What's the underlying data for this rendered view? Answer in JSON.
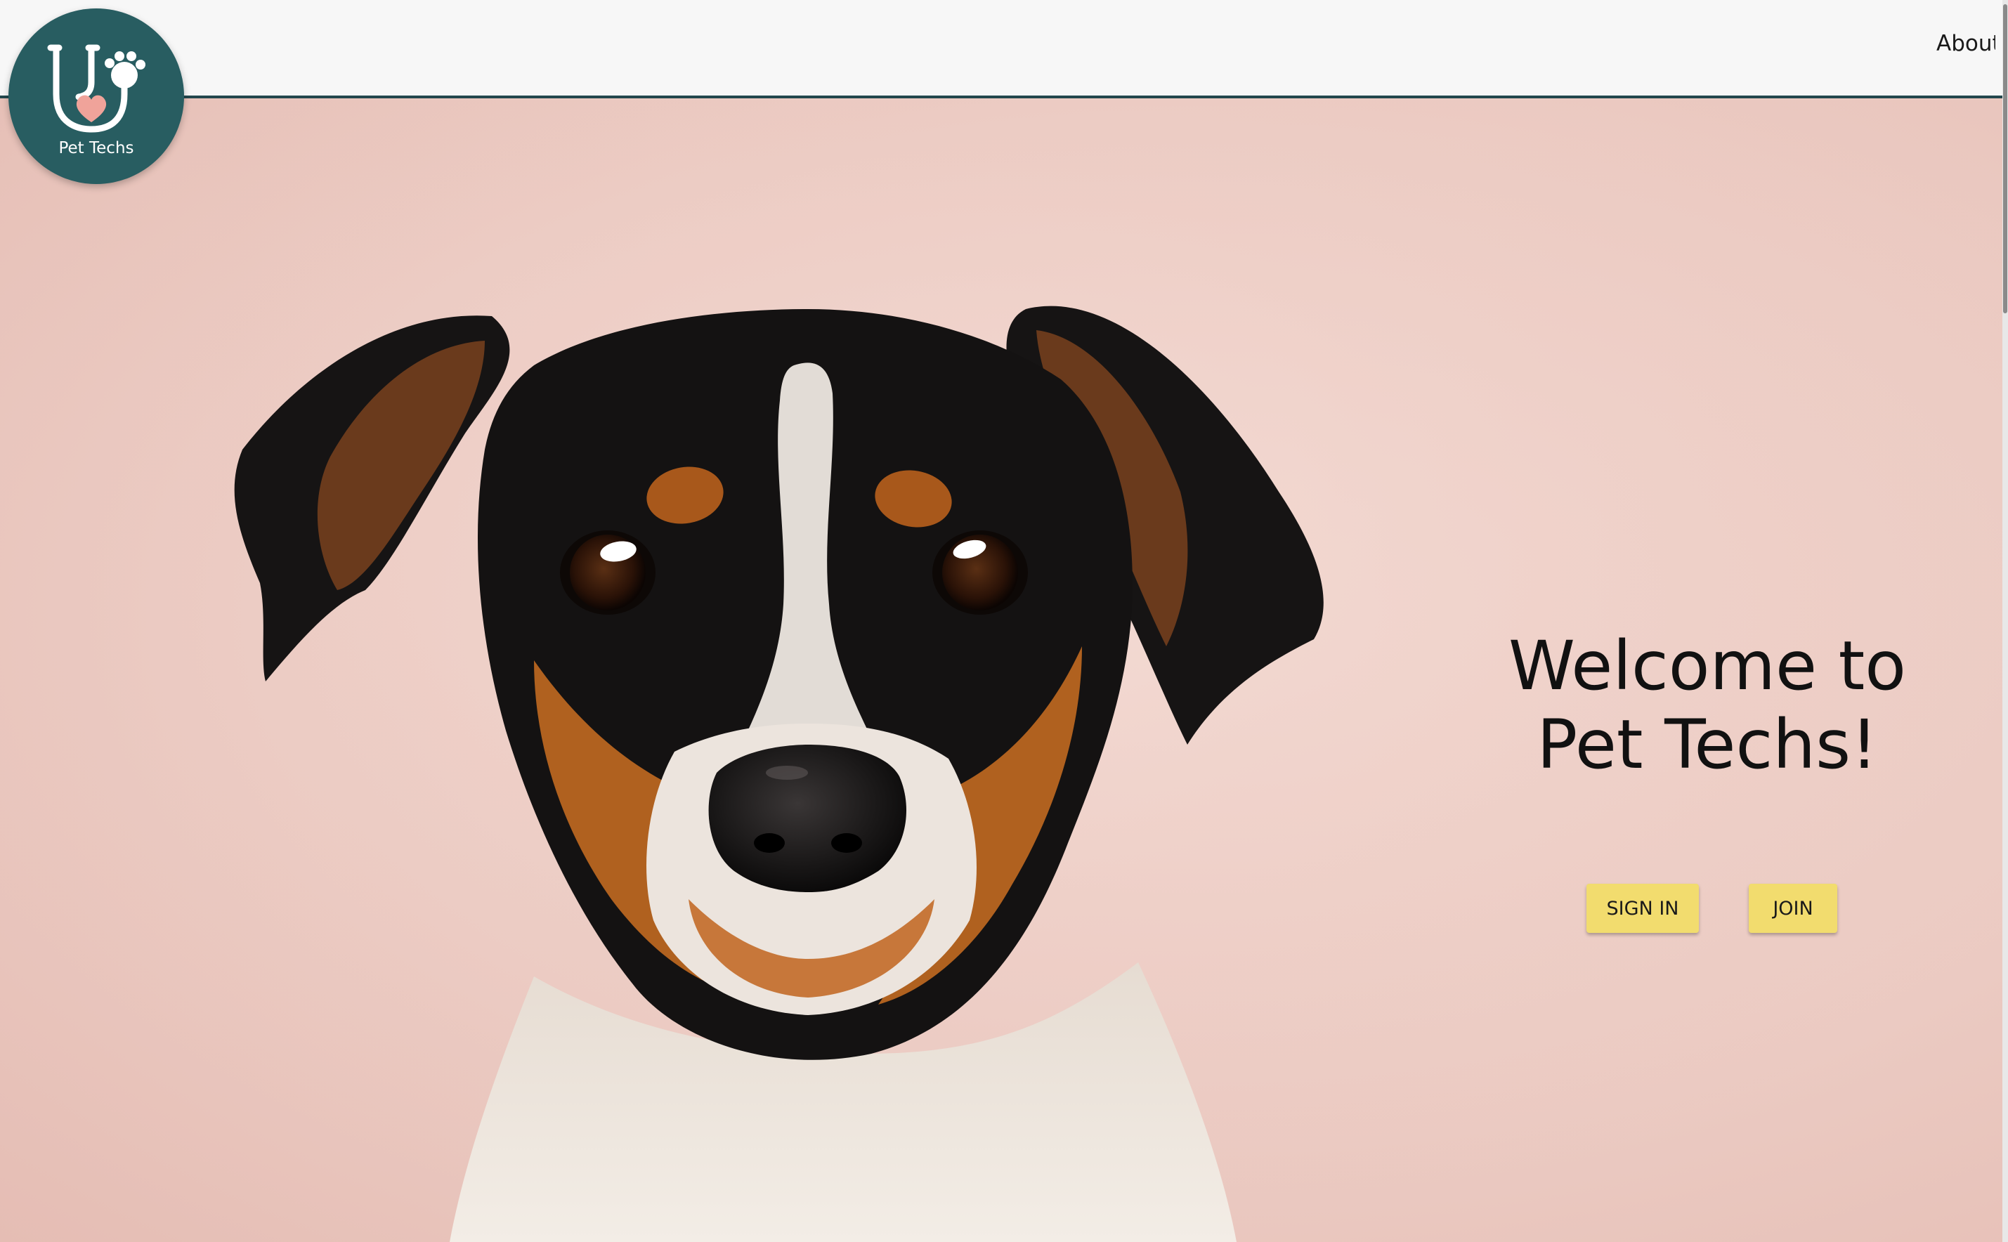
{
  "header": {
    "logo_text": "Pet Techs",
    "nav": {
      "about_label": "About"
    }
  },
  "hero": {
    "title": "Welcome to Pet Techs!",
    "sign_in_label": "SIGN IN",
    "join_label": "JOIN",
    "image_alt": "dog-photo"
  },
  "colors": {
    "brand_teal": "#285d61",
    "header_bg": "#f7f7f7",
    "button_yellow": "#f2dc6e",
    "hero_bg": "#efd3cc",
    "heart_pink": "#f0a39a"
  },
  "icons": [
    "stethoscope-icon",
    "paw-icon",
    "heart-icon"
  ]
}
